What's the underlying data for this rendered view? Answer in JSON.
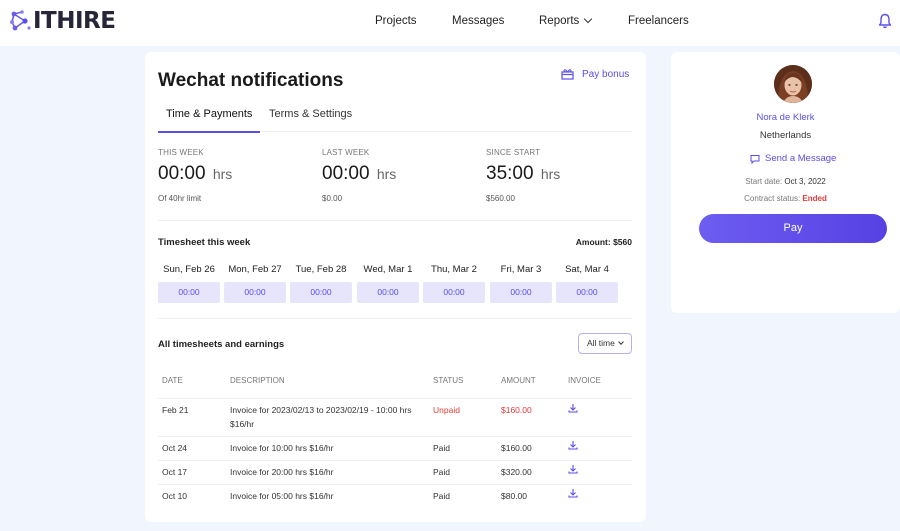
{
  "brand": {
    "name": "ITHIRE"
  },
  "nav": {
    "projects": "Projects",
    "messages": "Messages",
    "reports": "Reports",
    "freelancers": "Freelancers"
  },
  "page": {
    "title": "Wechat notifications",
    "pay_bonus": "Pay bonus"
  },
  "tabs": [
    {
      "label": "Time & Payments",
      "active": true
    },
    {
      "label": "Terms & Settings",
      "active": false
    }
  ],
  "stats": [
    {
      "label": "THIS WEEK",
      "value": "00:00",
      "unit": "hrs",
      "sub": "Of 40hr limit"
    },
    {
      "label": "LAST WEEK",
      "value": "00:00",
      "unit": "hrs",
      "sub": "$0.00"
    },
    {
      "label": "SINCE START",
      "value": "35:00",
      "unit": "hrs",
      "sub": "$560.00"
    }
  ],
  "timesheet": {
    "title": "Timesheet this week",
    "amount": "Amount: $560",
    "days": [
      {
        "label": "Sun, Feb 26",
        "hours": "00:00"
      },
      {
        "label": "Mon, Feb 27",
        "hours": "00:00"
      },
      {
        "label": "Tue, Feb 28",
        "hours": "00:00"
      },
      {
        "label": "Wed, Mar 1",
        "hours": "00:00"
      },
      {
        "label": "Thu, Mar 2",
        "hours": "00:00"
      },
      {
        "label": "Fri, Mar 3",
        "hours": "00:00"
      },
      {
        "label": "Sat, Mar 4",
        "hours": "00:00"
      }
    ]
  },
  "earnings": {
    "title": "All timesheets and earnings",
    "filter": "All time",
    "columns": {
      "date": "DATE",
      "description": "DESCRIPTION",
      "status": "STATUS",
      "amount": "AMOUNT",
      "invoice": "INVOICE"
    },
    "rows": [
      {
        "date": "Feb 21",
        "description": "Invoice for 2023/02/13 to 2023/02/19 - 10:00 hrs $16/hr",
        "status": "Unpaid",
        "amount": "$160.00"
      },
      {
        "date": "Oct 24",
        "description": "Invoice for 10:00 hrs $16/hr",
        "status": "Paid",
        "amount": "$160.00"
      },
      {
        "date": "Oct 17",
        "description": "Invoice for 20:00 hrs $16/hr",
        "status": "Paid",
        "amount": "$320.00"
      },
      {
        "date": "Oct 10",
        "description": "Invoice for 05:00 hrs $16/hr",
        "status": "Paid",
        "amount": "$80.00"
      }
    ]
  },
  "profile": {
    "name": "Nora de Klerk",
    "country": "Netherlands",
    "send_message": "Send a Message",
    "start_label": "Start date:",
    "start_value": "Oct 3, 2022",
    "status_label": "Contract status:",
    "status_value": "Ended",
    "pay": "Pay"
  },
  "colors": {
    "accent": "#5a4ee6",
    "danger": "#e23b3b",
    "background": "#f1f5fd"
  }
}
